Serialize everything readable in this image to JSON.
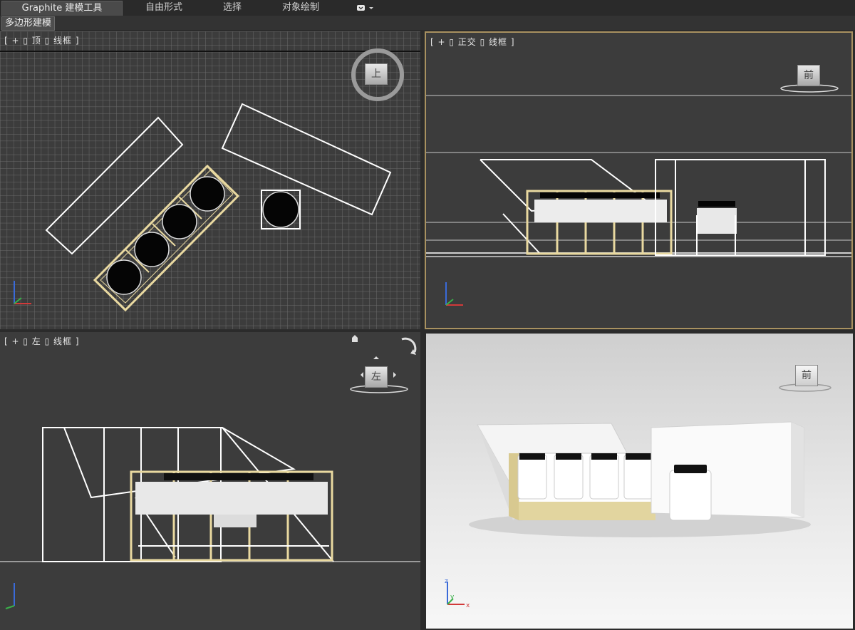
{
  "ribbon": {
    "tabs": [
      {
        "label": "Graphite 建模工具",
        "active": true
      },
      {
        "label": "自由形式"
      },
      {
        "label": "选择"
      },
      {
        "label": "对象绘制"
      }
    ],
    "dropdown_icon": "chevron-down-icon"
  },
  "subbar": {
    "label": "多边形建模"
  },
  "viewports": {
    "top": {
      "label": "[ + ▯ 顶 ▯ 线框 ]",
      "cube": "上"
    },
    "front": {
      "label": "[ + ▯ 正交 ▯ 线框 ]",
      "cube": "前"
    },
    "left": {
      "label": "[ + ▯ 左 ▯ 线框 ]",
      "cube": "左"
    },
    "persp": {
      "label": "",
      "cube": "前"
    }
  },
  "axes": {
    "x": "x",
    "y": "y",
    "z": "z"
  },
  "colors": {
    "bg": "#2b2b2b",
    "viewport": "#3c3c3c",
    "grid": "#6a6a6a",
    "wire": "#ffffff",
    "selected": "#e9d9a0",
    "active_border": "#a89160",
    "axis_x": "#d13a3a",
    "axis_y": "#3ab04a",
    "axis_z": "#3a6ad8",
    "persp_bg": "#e6e6e6",
    "box_gold": "#e2d59f"
  }
}
